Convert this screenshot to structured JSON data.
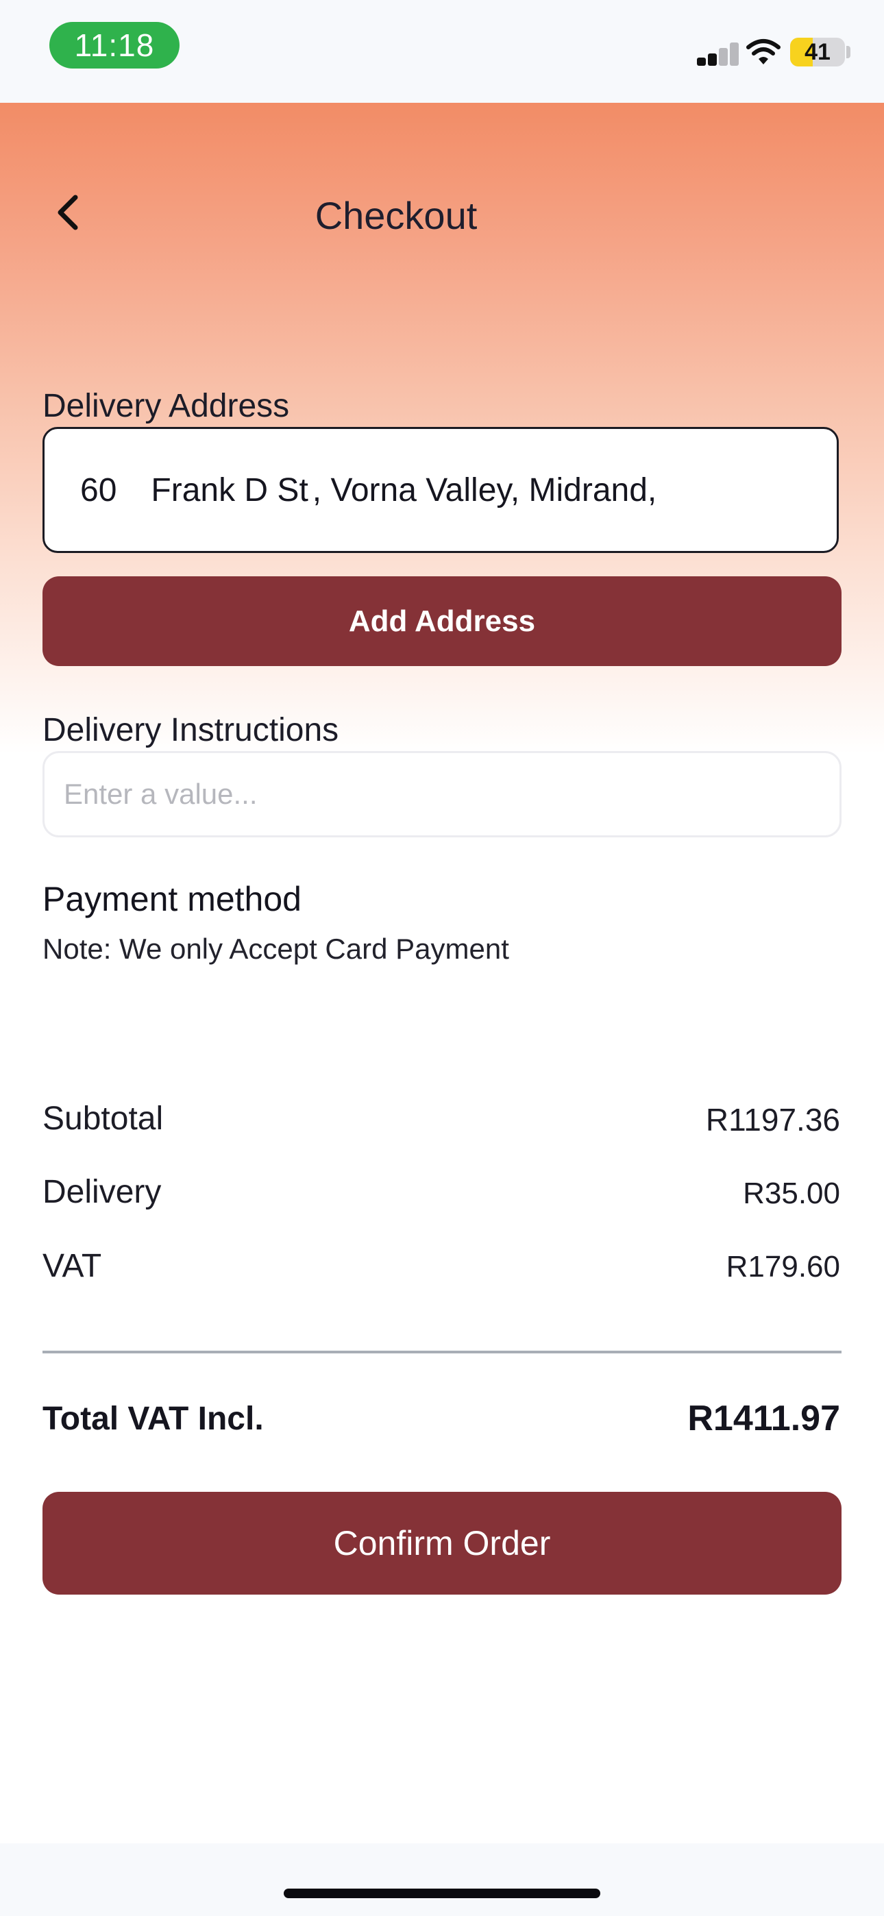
{
  "status_bar": {
    "time": "11:18",
    "battery_level": "41",
    "battery_fraction": 0.41,
    "icons": [
      "cellular-signal-icon",
      "wifi-icon",
      "battery-icon"
    ]
  },
  "header": {
    "title": "Checkout",
    "back_icon": "chevron-left-icon"
  },
  "delivery_address": {
    "label": "Delivery Address",
    "number": "60",
    "street": "Frank D St",
    "rest": ", Vorna Valley, Midrand,",
    "add_button": "Add Address"
  },
  "delivery_instructions": {
    "label": "Delivery Instructions",
    "value": "",
    "placeholder": "Enter a value..."
  },
  "payment": {
    "title": "Payment method",
    "note": "Note: We only Accept Card Payment"
  },
  "summary": {
    "rows": [
      {
        "label": "Subtotal",
        "value": "R1197.36"
      },
      {
        "label": "Delivery",
        "value": "R35.00"
      },
      {
        "label": "VAT",
        "value": "R179.60"
      }
    ],
    "total_label": "Total VAT Incl.",
    "total_value": "R1411.97"
  },
  "actions": {
    "confirm": "Confirm Order"
  },
  "colors": {
    "accent": "#853237",
    "header_gradient_top": "#f28c66",
    "status_time_pill": "#2fb24c",
    "battery_fill": "#f7d21e"
  }
}
